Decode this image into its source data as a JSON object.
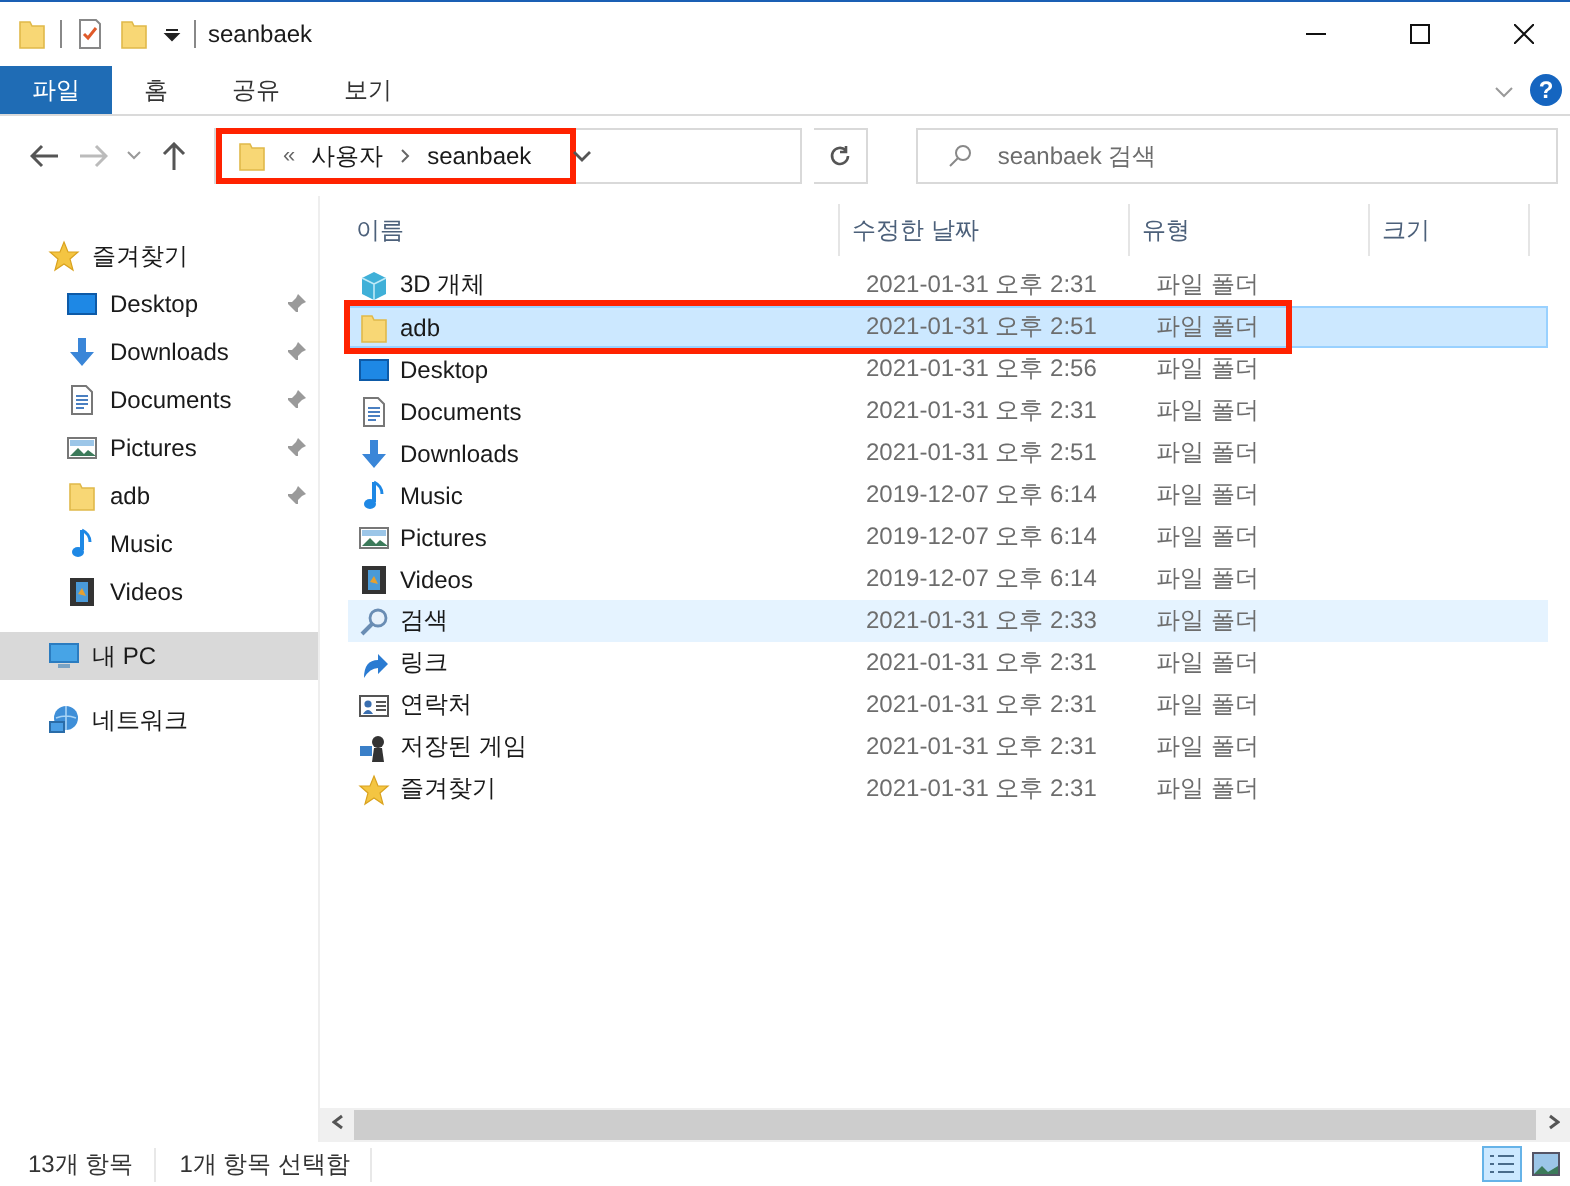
{
  "window": {
    "title": "seanbaek"
  },
  "ribbon": {
    "tabs": [
      {
        "label": "파일",
        "selected": true
      },
      {
        "label": "홈",
        "selected": false
      },
      {
        "label": "공유",
        "selected": false
      },
      {
        "label": "보기",
        "selected": false
      }
    ],
    "help": "?"
  },
  "address_bar": {
    "overflow": "«",
    "segments": [
      "사용자",
      "seanbaek"
    ],
    "highlighted": true
  },
  "search": {
    "placeholder": "seanbaek 검색"
  },
  "sidebar": {
    "items": [
      {
        "label": "즐겨찾기",
        "kind": "star",
        "selected": false,
        "children": [
          {
            "label": "Desktop",
            "kind": "desktop",
            "pinned": true,
            "selected": false
          },
          {
            "label": "Downloads",
            "kind": "downloads",
            "pinned": true,
            "selected": false
          },
          {
            "label": "Documents",
            "kind": "documents",
            "pinned": true,
            "selected": false
          },
          {
            "label": "Pictures",
            "kind": "pictures",
            "pinned": true,
            "selected": false
          },
          {
            "label": "adb",
            "kind": "folder",
            "pinned": true,
            "selected": false
          },
          {
            "label": "Music",
            "kind": "music",
            "pinned": false,
            "selected": false
          },
          {
            "label": "Videos",
            "kind": "videos",
            "pinned": false,
            "selected": false
          }
        ]
      },
      {
        "label": "내 PC",
        "kind": "pc",
        "selected": true
      },
      {
        "label": "네트워크",
        "kind": "network",
        "selected": false
      }
    ]
  },
  "table": {
    "columns": [
      "이름",
      "수정한 날짜",
      "유형",
      "크기"
    ],
    "rows": [
      {
        "name": "3D 개체",
        "kind": "cube",
        "modified": "2021-01-31 오후 2:31",
        "type": "파일 폴더",
        "selected": false,
        "hover": false,
        "highlighted": false
      },
      {
        "name": "adb",
        "kind": "folder",
        "modified": "2021-01-31 오후 2:51",
        "type": "파일 폴더",
        "selected": true,
        "hover": false,
        "highlighted": true
      },
      {
        "name": "Desktop",
        "kind": "desktop",
        "modified": "2021-01-31 오후 2:56",
        "type": "파일 폴더",
        "selected": false,
        "hover": false,
        "highlighted": false
      },
      {
        "name": "Documents",
        "kind": "documents",
        "modified": "2021-01-31 오후 2:31",
        "type": "파일 폴더",
        "selected": false,
        "hover": false,
        "highlighted": false
      },
      {
        "name": "Downloads",
        "kind": "downloads",
        "modified": "2021-01-31 오후 2:51",
        "type": "파일 폴더",
        "selected": false,
        "hover": false,
        "highlighted": false
      },
      {
        "name": "Music",
        "kind": "music",
        "modified": "2019-12-07 오후 6:14",
        "type": "파일 폴더",
        "selected": false,
        "hover": false,
        "highlighted": false
      },
      {
        "name": "Pictures",
        "kind": "pictures",
        "modified": "2019-12-07 오후 6:14",
        "type": "파일 폴더",
        "selected": false,
        "hover": false,
        "highlighted": false
      },
      {
        "name": "Videos",
        "kind": "videos",
        "modified": "2019-12-07 오후 6:14",
        "type": "파일 폴더",
        "selected": false,
        "hover": false,
        "highlighted": false
      },
      {
        "name": "검색",
        "kind": "search",
        "modified": "2021-01-31 오후 2:33",
        "type": "파일 폴더",
        "selected": false,
        "hover": true,
        "highlighted": false
      },
      {
        "name": "링크",
        "kind": "link",
        "modified": "2021-01-31 오후 2:31",
        "type": "파일 폴더",
        "selected": false,
        "hover": false,
        "highlighted": false
      },
      {
        "name": "연락처",
        "kind": "contacts",
        "modified": "2021-01-31 오후 2:31",
        "type": "파일 폴더",
        "selected": false,
        "hover": false,
        "highlighted": false
      },
      {
        "name": "저장된 게임",
        "kind": "games",
        "modified": "2021-01-31 오후 2:31",
        "type": "파일 폴더",
        "selected": false,
        "hover": false,
        "highlighted": false
      },
      {
        "name": "즐겨찾기",
        "kind": "star",
        "modified": "2021-01-31 오후 2:31",
        "type": "파일 폴더",
        "selected": false,
        "hover": false,
        "highlighted": false
      }
    ]
  },
  "status_bar": {
    "count": "13개 항목",
    "selection": "1개 항목 선택함"
  }
}
